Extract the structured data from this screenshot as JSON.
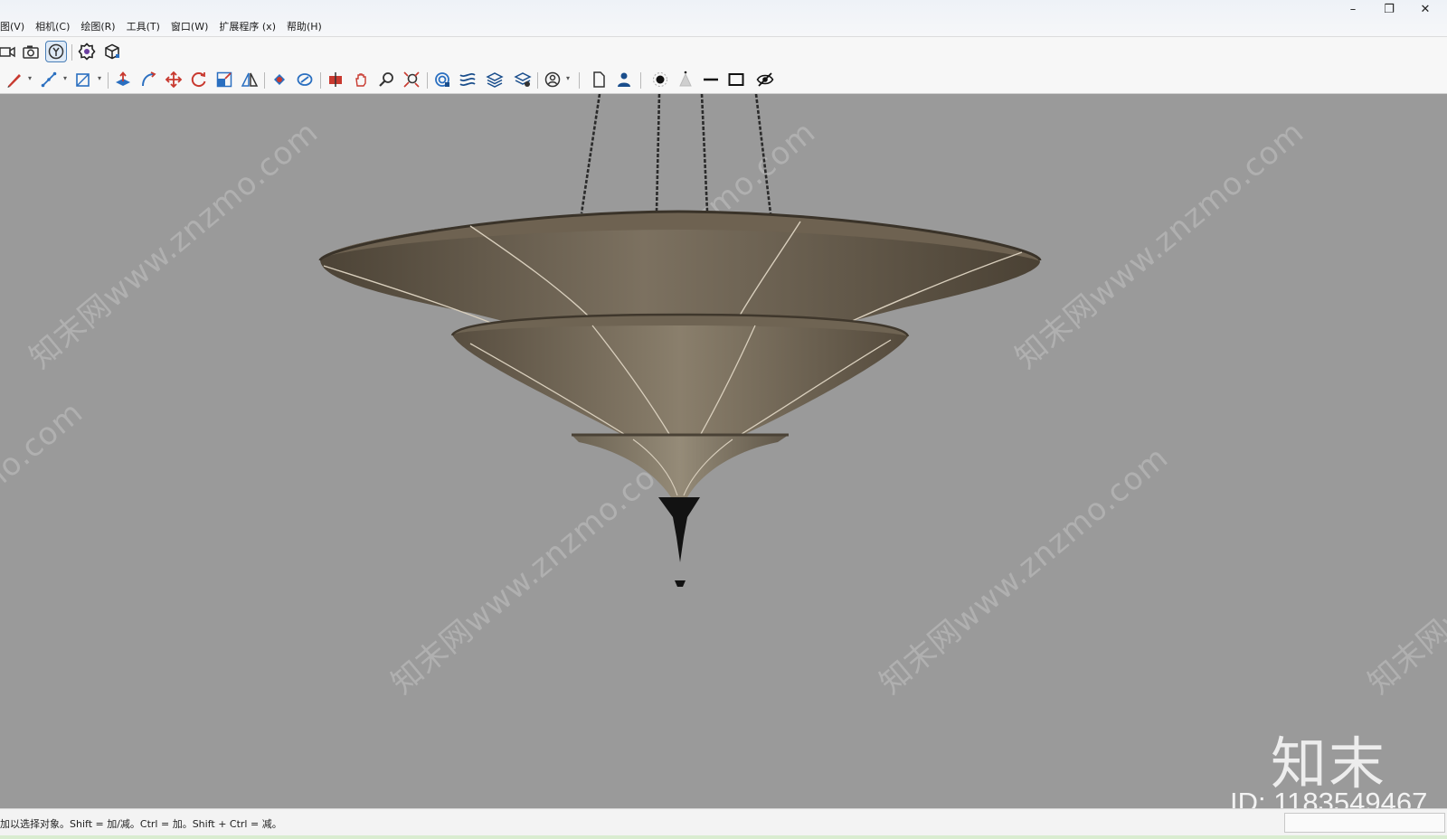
{
  "menu": {
    "items": [
      "图(V)",
      "相机(C)",
      "绘图(R)",
      "工具(T)",
      "窗口(W)",
      "扩展程序 (x)",
      "帮助(H)"
    ]
  },
  "window_controls": {
    "minimize": "–",
    "restore": "❐",
    "close": "✕"
  },
  "toolbar1": {
    "icons": [
      "video-camera-icon",
      "camera-icon",
      "position-camera-icon",
      "settings-gear-icon",
      "component-box-icon"
    ],
    "active": "position-camera-icon"
  },
  "toolbar2": {
    "icons": [
      "pencil-icon",
      "line-icon",
      "rectangle-icon",
      "push-pull-icon",
      "follow-me-icon",
      "move-icon",
      "rotate-icon",
      "scale-icon",
      "flip-icon",
      "paint-bucket-icon",
      "orbit-icon",
      "section-plane-icon",
      "pan-icon",
      "zoom-icon",
      "zoom-extents-icon",
      "solid-tools-icon",
      "sandbox-icon",
      "layers-icon",
      "layers-settings-icon",
      "user-account-icon",
      "new-page-icon",
      "person-icon",
      "shadow-point-icon",
      "cone-icon",
      "line-style-icon",
      "frame-icon",
      "hide-icon"
    ]
  },
  "viewport": {
    "background_color": "#9a9a9a",
    "watermark_text": "知末网www.znzmo.com",
    "brand_logo": "知末",
    "brand_id": "ID: 1183549467"
  },
  "status": {
    "hint": "加以选择对象。Shift = 加/减。Ctrl = 加。Shift + Ctrl = 减。"
  }
}
